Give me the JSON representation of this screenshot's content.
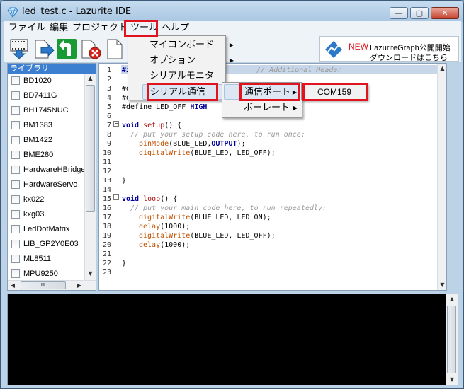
{
  "window": {
    "title": "led_test.c - Lazurite IDE",
    "minimize": "—",
    "maximize": "▢",
    "close": "✕"
  },
  "menu": {
    "file": "ファイル",
    "edit": "編集",
    "project": "プロジェクト",
    "tools": "ツール",
    "help": "ヘルプ"
  },
  "tools_menu": {
    "items": [
      "マイコンボード",
      "オプション",
      "シリアルモニタ",
      "シリアル通信"
    ],
    "serial_submenu": [
      "通信ポート",
      "ボーレート"
    ],
    "port": "COM159"
  },
  "promo": {
    "new": "NEW",
    "line1": "LazuriteGraph公開開始",
    "line2": "ダウンロードはこちら"
  },
  "library": {
    "header": "ライブラリ",
    "items": [
      "BD1020",
      "BD7411G",
      "BH1745NUC",
      "BM1383",
      "BM1422",
      "BME280",
      "HardwareHBridge",
      "HardwareServo",
      "kx022",
      "kxg03",
      "LedDotMatrix",
      "LIB_GP2Y0E03",
      "ML8511",
      "MPU9250"
    ],
    "hscroll_thumb": "III"
  },
  "editor": {
    "line_numbers": [
      "1",
      "2",
      "3",
      "4",
      "5",
      "6",
      "7",
      "8",
      "9",
      "10",
      "11",
      "12",
      "13",
      "14",
      "15",
      "16",
      "17",
      "18",
      "19",
      "20",
      "21",
      "22",
      "23"
    ],
    "line1_visible": "#i",
    "line1_comment": "// Additional Header",
    "line3": "#d",
    "line4": "#d",
    "line5_pre": "#define LED_OFF ",
    "line5_kw": "HIGH",
    "setup": {
      "kw": "void",
      "name": "setup",
      "rest": "() {",
      "comment": "// put your setup code here, to run once:",
      "l9_fn": "pinMode",
      "l9_args": "(BLUE_LED,",
      "l9_kw": "OUTPUT",
      "l9_end": ");",
      "l10_fn": "digitalWrite",
      "l10_args": "(BLUE_LED, LED_OFF);",
      "close": "}"
    },
    "loop": {
      "kw": "void",
      "name": "loop",
      "rest": "() {",
      "comment": "// put your main code here, to run repeatedly:",
      "l17_fn": "digitalWrite",
      "l17_args": "(BLUE_LED, LED_ON);",
      "l18_fn": "delay",
      "l18_args": "(1000);",
      "l19_fn": "digitalWrite",
      "l19_args": "(BLUE_LED, LED_OFF);",
      "l20_fn": "delay",
      "l20_args": "(1000);",
      "close": "}"
    }
  },
  "colors": {
    "highlight": "#e0141e",
    "library_header": "#3c7fd1",
    "keyword": "#000099",
    "function": "#b01010"
  }
}
